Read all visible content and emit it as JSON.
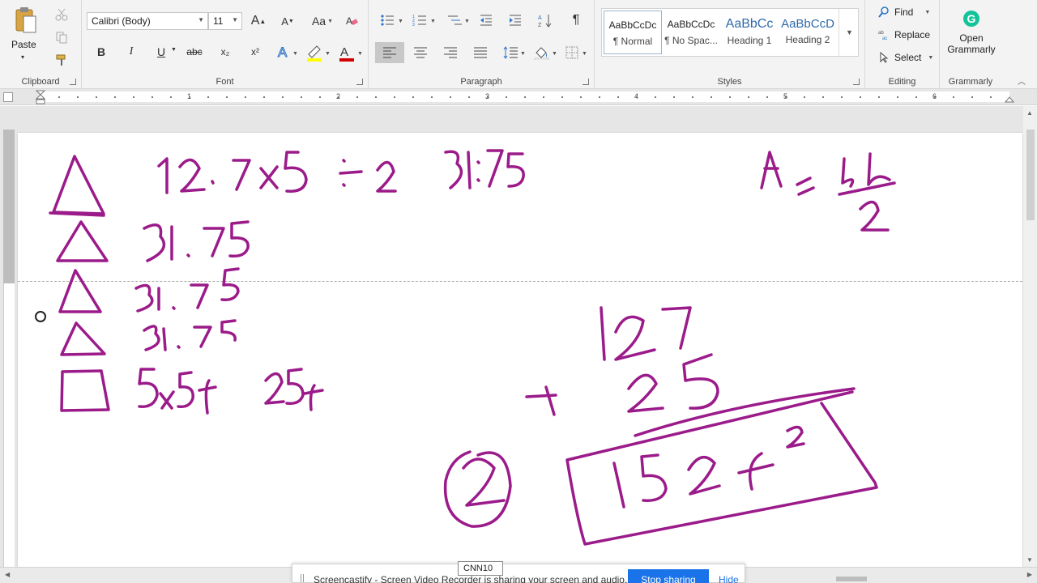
{
  "clipboard": {
    "paste_label": "Paste",
    "group_label": "Clipboard"
  },
  "font": {
    "name": "Calibri (Body)",
    "size": "11",
    "group_label": "Font",
    "bold": "B",
    "italic": "I",
    "underline": "U",
    "strike": "abc",
    "subscript": "x₂",
    "superscript": "x²",
    "grow": "A",
    "shrink": "A",
    "case": "Aa",
    "highlight_color": "#ffff00",
    "font_color": "#d00000"
  },
  "paragraph": {
    "group_label": "Paragraph"
  },
  "styles": {
    "group_label": "Styles",
    "items": [
      {
        "sample": "AaBbCcDc",
        "name": "¶ Normal"
      },
      {
        "sample": "AaBbCcDc",
        "name": "¶ No Spac..."
      },
      {
        "sample": "AaBbCc",
        "name": "Heading 1"
      },
      {
        "sample": "AaBbCcD",
        "name": "Heading 2"
      }
    ]
  },
  "editing": {
    "group_label": "Editing",
    "find": "Find",
    "replace": "Replace",
    "select": "Select"
  },
  "grammarly": {
    "group_label": "Grammarly",
    "button_line1": "Open",
    "button_line2": "Grammarly",
    "color": "#15c39a"
  },
  "ruler": {
    "numbers": [
      "1",
      "2",
      "3",
      "4",
      "5",
      "6"
    ]
  },
  "ink_color": "#9b1b8a",
  "screencastify": {
    "tab_label": "CNN10",
    "message": "Screencastify - Screen Video Recorder is sharing your screen and audio.",
    "stop_label": "Stop sharing",
    "hide_label": "Hide",
    "accent": "#1a73e8"
  }
}
